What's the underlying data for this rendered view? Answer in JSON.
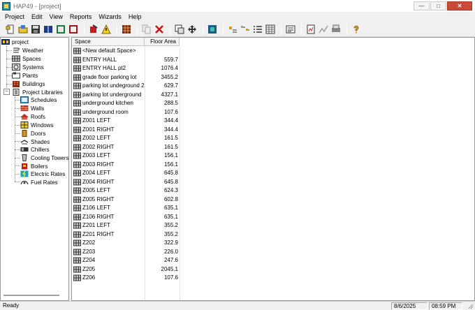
{
  "window": {
    "title": "HAP49 - [project]",
    "controls": [
      "minimize",
      "maximize",
      "close"
    ]
  },
  "menu": [
    "Project",
    "Edit",
    "View",
    "Reports",
    "Wizards",
    "Help"
  ],
  "toolbar": {
    "icons": [
      "new-project-icon",
      "open-icon",
      "save-icon",
      "library-icon",
      "archive-icon",
      "report-icon",
      "cut-icon",
      "warning-icon",
      "grid-icon",
      "copy-icon",
      "delete-icon",
      "properties-icon",
      "move-icon",
      "building-view-icon",
      "large-icons-icon",
      "small-icons-icon",
      "list-view-icon",
      "details-view-icon",
      "summary-icon",
      "calculate-icon",
      "chart-icon",
      "print-icon",
      "help-icon"
    ]
  },
  "tree": {
    "root": "project",
    "items": [
      {
        "label": "Weather",
        "icon": "weather-icon"
      },
      {
        "label": "Spaces",
        "icon": "spaces-icon"
      },
      {
        "label": "Systems",
        "icon": "systems-icon"
      },
      {
        "label": "Plants",
        "icon": "plants-icon"
      },
      {
        "label": "Buildings",
        "icon": "buildings-icon"
      }
    ],
    "libraries": {
      "label": "Project Libraries",
      "items": [
        {
          "label": "Schedules",
          "icon": "schedules-icon"
        },
        {
          "label": "Walls",
          "icon": "walls-icon"
        },
        {
          "label": "Roofs",
          "icon": "roofs-icon"
        },
        {
          "label": "Windows",
          "icon": "windows-icon"
        },
        {
          "label": "Doors",
          "icon": "doors-icon"
        },
        {
          "label": "Shades",
          "icon": "shades-icon"
        },
        {
          "label": "Chillers",
          "icon": "chillers-icon"
        },
        {
          "label": "Cooling Towers",
          "icon": "cooling-towers-icon"
        },
        {
          "label": "Boilers",
          "icon": "boilers-icon"
        },
        {
          "label": "Electric Rates",
          "icon": "electric-rates-icon"
        },
        {
          "label": "Fuel Rates",
          "icon": "fuel-rates-icon"
        }
      ]
    }
  },
  "table": {
    "columns": [
      "Space",
      "Floor Area"
    ],
    "rows": [
      {
        "space": "<New default Space>",
        "area": ""
      },
      {
        "space": "ENTRY HALL",
        "area": "559.7"
      },
      {
        "space": "ENTRY HALL pt2",
        "area": "1076.4"
      },
      {
        "space": "grade floor parking lot",
        "area": "3455.2"
      },
      {
        "space": "parking lot undeground 2",
        "area": "629.7"
      },
      {
        "space": "parking lot underground",
        "area": "4327.1"
      },
      {
        "space": "underground kitchen",
        "area": "288.5"
      },
      {
        "space": "underground room",
        "area": "107.6"
      },
      {
        "space": "Z001 LEFT",
        "area": "344.4"
      },
      {
        "space": "Z001 RIGHT",
        "area": "344.4"
      },
      {
        "space": "Z002 LEFT",
        "area": "161.5"
      },
      {
        "space": "Z002 RIGHT",
        "area": "161.5"
      },
      {
        "space": "Z003 LEFT",
        "area": "156.1"
      },
      {
        "space": "Z003 RIGHT",
        "area": "156.1"
      },
      {
        "space": "Z004 LEFT",
        "area": "645.8"
      },
      {
        "space": "Z004 RIGHT",
        "area": "645.8"
      },
      {
        "space": "Z005 LEFT",
        "area": "624.3"
      },
      {
        "space": "Z005 RIGHT",
        "area": "602.8"
      },
      {
        "space": "Z106 LEFT",
        "area": "635.1"
      },
      {
        "space": "Z106 RIGHT",
        "area": "635.1"
      },
      {
        "space": "Z201 LEFT",
        "area": "355.2"
      },
      {
        "space": "Z201 RIGHT",
        "area": "355.2"
      },
      {
        "space": "Z202",
        "area": "322.9"
      },
      {
        "space": "Z203",
        "area": "226.0"
      },
      {
        "space": "Z204",
        "area": "247.6"
      },
      {
        "space": "Z205",
        "area": "2045.1"
      },
      {
        "space": "Z206",
        "area": "107.6"
      }
    ]
  },
  "status": {
    "text": "Ready",
    "date": "8/6/2025",
    "time": "08:59 PM"
  }
}
